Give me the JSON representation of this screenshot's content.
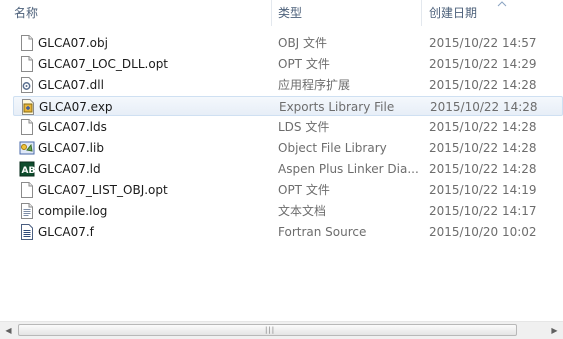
{
  "columns": {
    "name": "名称",
    "type": "类型",
    "date": "创建日期"
  },
  "files": [
    {
      "name": "GLCA07.obj",
      "type": "OBJ 文件",
      "date": "2015/10/22 14:57",
      "icon": "blank-file-icon",
      "selected": false
    },
    {
      "name": "GLCA07_LOC_DLL.opt",
      "type": "OPT 文件",
      "date": "2015/10/22 14:29",
      "icon": "blank-file-icon",
      "selected": false
    },
    {
      "name": "GLCA07.dll",
      "type": "应用程序扩展",
      "date": "2015/10/22 14:28",
      "icon": "dll-gear-icon",
      "selected": false
    },
    {
      "name": "GLCA07.exp",
      "type": "Exports Library File",
      "date": "2015/10/22 14:28",
      "icon": "exp-file-icon",
      "selected": true
    },
    {
      "name": "GLCA07.lds",
      "type": "LDS 文件",
      "date": "2015/10/22 14:28",
      "icon": "blank-file-icon",
      "selected": false
    },
    {
      "name": "GLCA07.lib",
      "type": "Object File Library",
      "date": "2015/10/22 14:28",
      "icon": "lib-file-icon",
      "selected": false
    },
    {
      "name": "GLCA07.ld",
      "type": "Aspen Plus Linker Dia...",
      "date": "2015/10/22 14:28",
      "icon": "aspen-file-icon",
      "selected": false
    },
    {
      "name": "GLCA07_LIST_OBJ.opt",
      "type": "OPT 文件",
      "date": "2015/10/22 14:19",
      "icon": "blank-file-icon",
      "selected": false
    },
    {
      "name": "compile.log",
      "type": "文本文档",
      "date": "2015/10/22 14:17",
      "icon": "text-file-icon",
      "selected": false
    },
    {
      "name": "GLCA07.f",
      "type": "Fortran Source",
      "date": "2015/10/20 10:02",
      "icon": "fortran-file-icon",
      "selected": false
    }
  ],
  "colors": {
    "selection": "#e7eef7",
    "header_text": "#4c607a",
    "secondary_text": "#6d6d6d"
  }
}
